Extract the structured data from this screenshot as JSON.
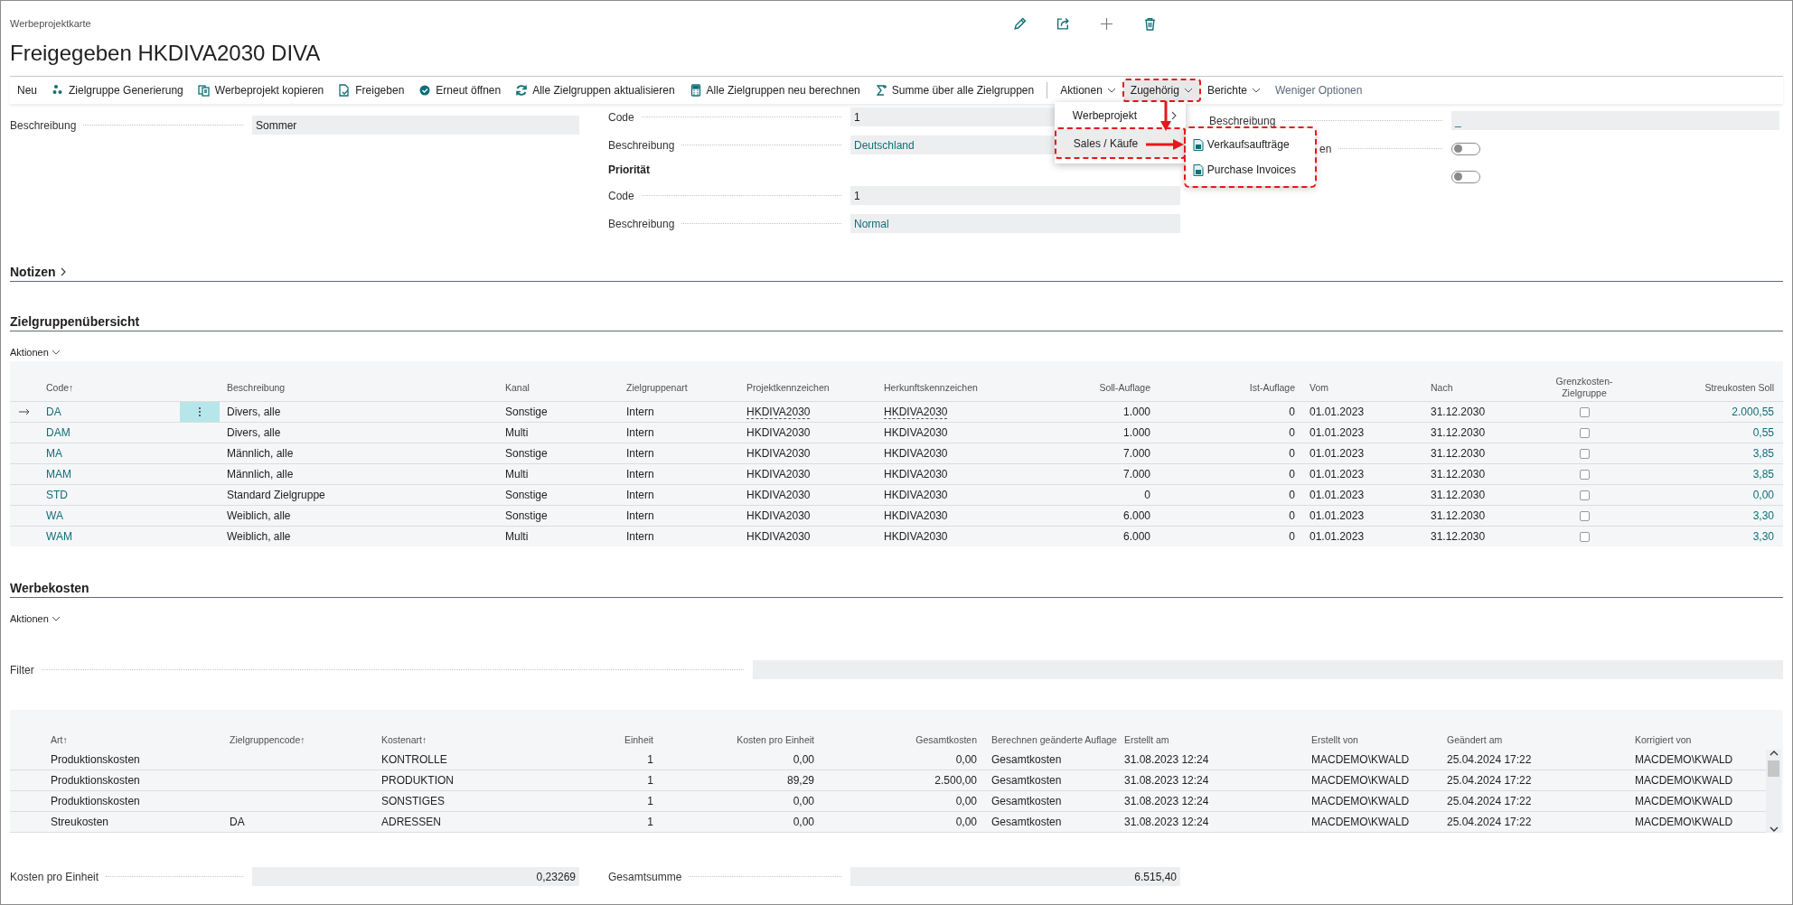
{
  "breadcrumb": "Werbeprojektkarte",
  "title": "Freigegeben HKDIVA2030 DIVA",
  "toolbar": [
    {
      "kind": "action",
      "label": "Neu"
    },
    {
      "kind": "action",
      "label": "Zielgruppe Generierung"
    },
    {
      "kind": "action",
      "label": "Werbeprojekt kopieren"
    },
    {
      "kind": "action",
      "label": "Freigeben"
    },
    {
      "kind": "action",
      "label": "Erneut öffnen"
    },
    {
      "kind": "action",
      "label": "Alle Zielgruppen aktualisieren"
    },
    {
      "kind": "action",
      "label": "Alle Zielgruppen neu berechnen"
    },
    {
      "kind": "action",
      "label": "Summe über alle Zielgruppen"
    },
    {
      "kind": "separator"
    },
    {
      "kind": "menu",
      "label": "Aktionen",
      "selected": false,
      "highlighted": false
    },
    {
      "kind": "menu",
      "label": "Zugehörig",
      "selected": true,
      "highlighted": true
    },
    {
      "kind": "menu",
      "label": "Berichte",
      "selected": false,
      "highlighted": false
    },
    {
      "kind": "link",
      "label": "Weniger Optionen"
    }
  ],
  "menu": {
    "items": [
      {
        "label": "Werbeprojekt",
        "selected": false,
        "highlighted": false,
        "has_submenu": true
      },
      {
        "label": "Sales / Käufe",
        "selected": true,
        "highlighted": true,
        "has_submenu": false
      }
    ],
    "submenu": {
      "highlighted": true,
      "items": [
        {
          "label": "Verkaufsaufträge"
        },
        {
          "label": "Purchase Invoices"
        }
      ]
    }
  },
  "fields": [
    [
      {
        "kind": "text",
        "label": "Beschreibung",
        "value": "Sommer"
      }
    ],
    [
      {
        "kind": "text",
        "label": "Code",
        "value": "1"
      },
      {
        "kind": "link",
        "label": "Beschreibung",
        "value": "Deutschland"
      },
      {
        "kind": "heading",
        "label": "Priorität"
      },
      {
        "kind": "text",
        "label": "Code",
        "value": "1"
      },
      {
        "kind": "link",
        "label": "Beschreibung",
        "value": "Normal"
      }
    ],
    [
      {
        "kind": "link",
        "label": "Beschreibung",
        "value": "_"
      },
      {
        "kind": "toggle",
        "label": "en",
        "covered": true,
        "on": false
      },
      {
        "kind": "toggle",
        "on": false
      }
    ]
  ],
  "notes": {
    "title": "Notizen",
    "expanded": false
  },
  "target_groups": {
    "title": "Zielgruppenübersicht",
    "actions": "Aktionen",
    "columns": [
      "Code↑",
      "Beschreibung",
      "Kanal",
      "Zielgruppenart",
      "Projektkennzeichen",
      "Herkunftskennzeichen",
      "Soll-Auflage",
      "Ist-Auflage",
      "Vom",
      "Nach",
      "Grenzkosten-Zielgruppe",
      "Streukosten Soll"
    ],
    "rows": [
      {
        "selected": true,
        "cells": [
          "DA",
          "Divers, alle",
          "Sonstige",
          "Intern",
          "HKDIVA2030",
          "HKDIVA2030",
          "1.000",
          "0",
          "01.01.2023",
          "31.12.2030"
        ],
        "checked": false,
        "cost": "2.000,55"
      },
      {
        "selected": false,
        "cells": [
          "DAM",
          "Divers, alle",
          "Multi",
          "Intern",
          "HKDIVA2030",
          "HKDIVA2030",
          "1.000",
          "0",
          "01.01.2023",
          "31.12.2030"
        ],
        "checked": false,
        "cost": "0,55"
      },
      {
        "selected": false,
        "cells": [
          "MA",
          "Männlich, alle",
          "Sonstige",
          "Intern",
          "HKDIVA2030",
          "HKDIVA2030",
          "7.000",
          "0",
          "01.01.2023",
          "31.12.2030"
        ],
        "checked": false,
        "cost": "3,85"
      },
      {
        "selected": false,
        "cells": [
          "MAM",
          "Männlich, alle",
          "Multi",
          "Intern",
          "HKDIVA2030",
          "HKDIVA2030",
          "7.000",
          "0",
          "01.01.2023",
          "31.12.2030"
        ],
        "checked": false,
        "cost": "3,85"
      },
      {
        "selected": false,
        "cells": [
          "STD",
          "Standard Zielgruppe",
          "Sonstige",
          "Intern",
          "HKDIVA2030",
          "HKDIVA2030",
          "0",
          "0",
          "01.01.2023",
          "31.12.2030"
        ],
        "checked": false,
        "cost": "0,00"
      },
      {
        "selected": false,
        "cells": [
          "WA",
          "Weiblich, alle",
          "Sonstige",
          "Intern",
          "HKDIVA2030",
          "HKDIVA2030",
          "6.000",
          "0",
          "01.01.2023",
          "31.12.2030"
        ],
        "checked": false,
        "cost": "3,30"
      },
      {
        "selected": false,
        "cells": [
          "WAM",
          "Weiblich, alle",
          "Multi",
          "Intern",
          "HKDIVA2030",
          "HKDIVA2030",
          "6.000",
          "0",
          "01.01.2023",
          "31.12.2030"
        ],
        "checked": false,
        "cost": "3,30"
      }
    ]
  },
  "costs": {
    "title": "Werbekosten",
    "actions": "Aktionen",
    "filter_label": "Filter",
    "columns": [
      "Art↑",
      "Zielgruppencode↑",
      "Kostenart↑",
      "Einheit",
      "Kosten pro Einheit",
      "Gesamtkosten",
      "Berechnen geänderte Auflage",
      "Erstellt am",
      "Erstellt von",
      "Geändert am",
      "Korrigiert von"
    ],
    "rows": [
      {
        "cells": [
          "Produktionskosten",
          "",
          "KONTROLLE",
          "1",
          "0,00",
          "0,00",
          "Gesamtkosten",
          "31.08.2023 12:24",
          "MACDEMO\\KWALD",
          "25.04.2024 17:22",
          "MACDEMO\\KWALD"
        ]
      },
      {
        "cells": [
          "Produktionskosten",
          "",
          "PRODUKTION",
          "1",
          "89,29",
          "2.500,00",
          "Gesamtkosten",
          "31.08.2023 12:24",
          "MACDEMO\\KWALD",
          "25.04.2024 17:22",
          "MACDEMO\\KWALD"
        ]
      },
      {
        "cells": [
          "Produktionskosten",
          "",
          "SONSTIGES",
          "1",
          "0,00",
          "0,00",
          "Gesamtkosten",
          "31.08.2023 12:24",
          "MACDEMO\\KWALD",
          "25.04.2024 17:22",
          "MACDEMO\\KWALD"
        ]
      },
      {
        "cells": [
          "Streukosten",
          "DA",
          "ADRESSEN",
          "1",
          "0,00",
          "0,00",
          "Gesamtkosten",
          "31.08.2023 12:24",
          "MACDEMO\\KWALD",
          "25.04.2024 17:22",
          "MACDEMO\\KWALD"
        ]
      }
    ]
  },
  "totals": [
    {
      "label": "Kosten pro Einheit",
      "value": "0,23269"
    },
    {
      "label": "Gesamtsumme",
      "value": "6.515,40"
    }
  ]
}
